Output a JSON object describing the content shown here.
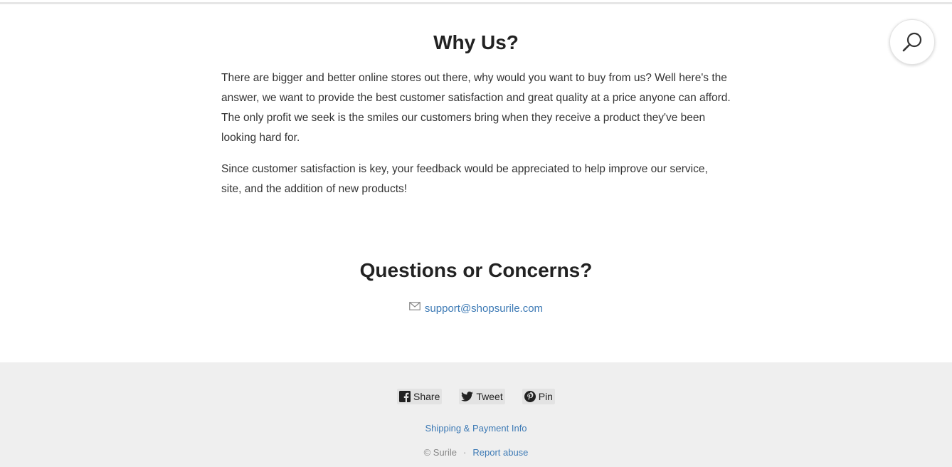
{
  "why_us": {
    "title": "Why Us?",
    "paragraph_1": "There are bigger and better online stores out there, why would you want to buy from us? Well here's the answer, we want to provide the best customer satisfaction and great quality at a price anyone can afford. The only profit we seek is the smiles our customers bring when they receive a product they've been looking hard for.",
    "paragraph_2": "Since customer satisfaction is key, your feedback would be appreciated to help improve our service, site, and the addition of new products!"
  },
  "questions": {
    "title": "Questions or Concerns?",
    "email": "support@shopsurile.com",
    "email_icon": "mail-icon"
  },
  "search": {
    "icon": "search-icon"
  },
  "footer": {
    "share_buttons": [
      {
        "label": "Share",
        "icon": "facebook-icon"
      },
      {
        "label": "Tweet",
        "icon": "twitter-icon"
      },
      {
        "label": "Pin",
        "icon": "pinterest-icon"
      }
    ],
    "shipping_link": "Shipping & Payment Info",
    "copyright": "© Surile",
    "separator": "·",
    "report_link": "Report abuse"
  },
  "colors": {
    "link": "#3d7ab5",
    "footer_bg": "#efefef",
    "heading": "#222222",
    "body_text": "#333333"
  }
}
